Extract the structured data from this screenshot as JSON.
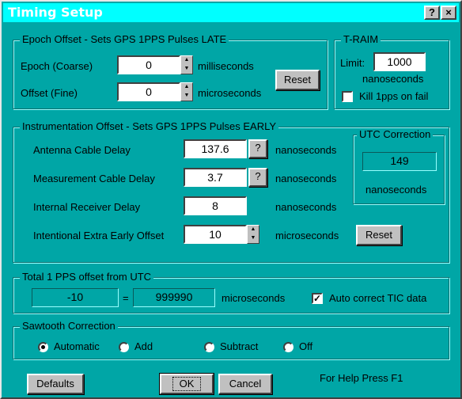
{
  "window": {
    "title": "Timing Setup",
    "help_btn": "?",
    "close_btn": "×"
  },
  "epoch": {
    "title": "Epoch Offset - Sets GPS 1PPS Pulses LATE",
    "coarse_label": "Epoch (Coarse)",
    "coarse_value": "0",
    "coarse_unit": "milliseconds",
    "fine_label": "Offset (Fine)",
    "fine_value": "0",
    "fine_unit": "microseconds",
    "reset": "Reset"
  },
  "traim": {
    "title": "T-RAIM",
    "limit_label": "Limit:",
    "limit_value": "1000",
    "limit_unit": "nanoseconds",
    "kill_label": "Kill 1pps on fail",
    "kill_checked": false
  },
  "instr": {
    "title": "Instrumentation Offset - Sets GPS 1PPS Pulses EARLY",
    "antenna_label": "Antenna Cable Delay",
    "antenna_value": "137.6",
    "meas_label": "Measurement Cable Delay",
    "meas_value": "3.7",
    "internal_label": "Internal Receiver Delay",
    "internal_value": "8",
    "extra_label": "Intentional Extra Early Offset",
    "extra_value": "10",
    "unit_ns": "nanoseconds",
    "unit_us": "microseconds",
    "q": "?",
    "reset": "Reset"
  },
  "utc": {
    "title": "UTC Correction",
    "value": "149",
    "unit": "nanoseconds"
  },
  "total": {
    "title": "Total 1 PPS offset from UTC",
    "left_value": "-10",
    "equals": "=",
    "right_value": "999990",
    "unit": "microseconds",
    "auto_label": "Auto correct TIC data",
    "auto_checked": true
  },
  "sawtooth": {
    "title": "Sawtooth Correction",
    "options": [
      "Automatic",
      "Add",
      "Subtract",
      "Off"
    ],
    "selected": "Automatic"
  },
  "footer": {
    "defaults": "Defaults",
    "ok": "OK",
    "cancel": "Cancel",
    "help": "For Help Press F1"
  }
}
